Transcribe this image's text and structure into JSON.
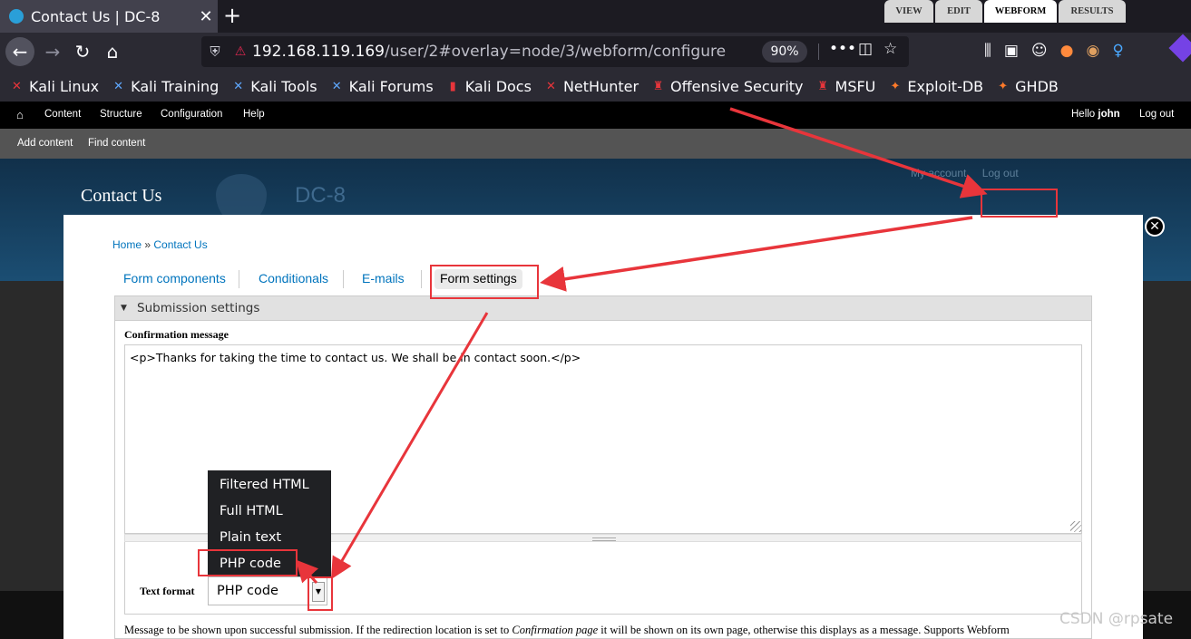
{
  "browser": {
    "tab_title": "Contact Us | DC-8",
    "tab_close": "✕",
    "new_tab": "+",
    "url_host": "192.168.119.169",
    "url_path": "/user/2#overlay=node/3/webform/configure",
    "zoom": "90%",
    "page_actions": "•••",
    "bookmarks": [
      "Kali Linux",
      "Kali Training",
      "Kali Tools",
      "Kali Forums",
      "Kali Docs",
      "NetHunter",
      "Offensive Security",
      "MSFU",
      "Exploit-DB",
      "GHDB"
    ]
  },
  "admin_menu": {
    "items": [
      "Content",
      "Structure",
      "Configuration",
      "Help"
    ],
    "hello_prefix": "Hello ",
    "user": "john",
    "logout": "Log out"
  },
  "shortcuts": {
    "items": [
      "Add content",
      "Find content"
    ]
  },
  "site": {
    "overlay_title": "Contact Us",
    "site_name": "DC-8",
    "secondary_links": [
      "My account",
      "Log out"
    ]
  },
  "overlay_tabs": [
    "VIEW",
    "EDIT",
    "WEBFORM",
    "RESULTS"
  ],
  "breadcrumb": {
    "home": "Home",
    "sep": " » ",
    "current": "Contact Us"
  },
  "sub_tabs": [
    "Form components",
    "Conditionals",
    "E-mails",
    "Form settings"
  ],
  "fieldset": {
    "legend": "Submission settings",
    "toggle": "▼"
  },
  "confirmation": {
    "label": "Confirmation message",
    "value": "<p>Thanks for taking the time to contact us. We shall be in contact soon.</p>"
  },
  "text_format": {
    "label": "Text format",
    "selected": "PHP code",
    "arrow": "▼",
    "options": [
      "Filtered HTML",
      "Full HTML",
      "Plain text",
      "PHP code"
    ]
  },
  "description": {
    "part1": "Message to be shown upon successful submission. If the redirection location is set to ",
    "italic": "Confirmation page",
    "part2": " it will be shown on its own page, otherwise this displays as a message. Supports Webform"
  },
  "watermark": "CSDN @rpsate",
  "colors": {
    "highlight": "#e8353b",
    "link": "#0074bd",
    "admin_bar": "#000000"
  },
  "icons": {
    "home": "home-icon",
    "reload": "reload-icon",
    "back": "back-arrow-icon",
    "close": "close-icon"
  }
}
